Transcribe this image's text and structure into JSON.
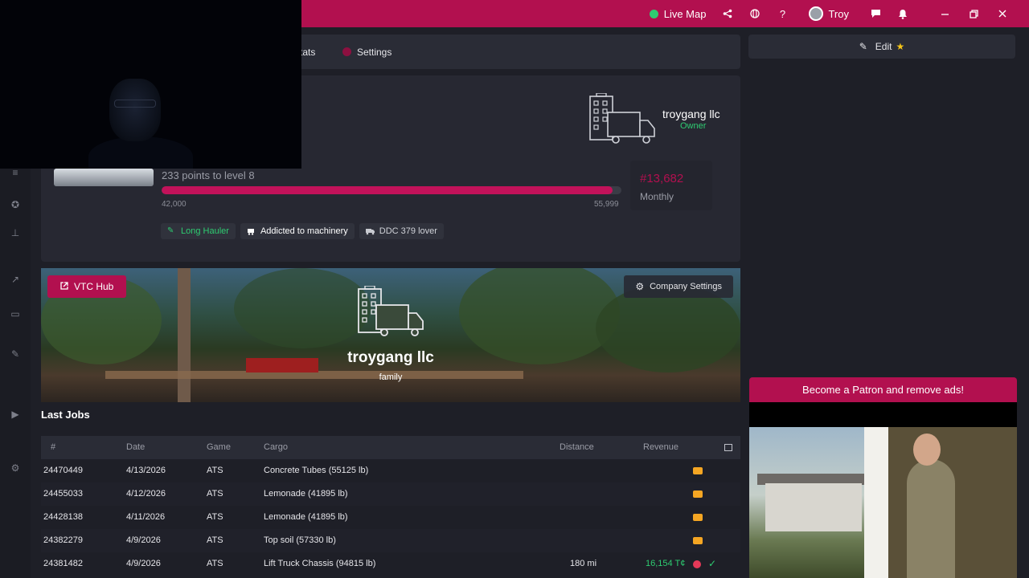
{
  "topbar": {
    "live_map": "Live Map",
    "user_name": "Troy",
    "icons": [
      "share-icon",
      "globe-icon",
      "help-icon",
      "chat-icon",
      "bell-icon",
      "minimize-icon",
      "restore-icon",
      "close-icon"
    ]
  },
  "nav": {
    "tabs": [
      {
        "label": "tats"
      },
      {
        "label": "Settings"
      }
    ]
  },
  "profile": {
    "points_text": "233 points to level 8",
    "level_progress": 0.98,
    "level_min": "42,000",
    "level_max": "55,999",
    "rank": "#13,682",
    "rank_period": "Monthly",
    "company_name": "troygang llc",
    "company_role": "Owner",
    "badges": [
      {
        "label": "Long Hauler",
        "color": "#2ecc71"
      },
      {
        "label": "Addicted to machinery",
        "color": "#ffffff"
      },
      {
        "label": "DDC 379 lover",
        "color": "#d0d2d8"
      }
    ]
  },
  "banner": {
    "vtc_hub": "VTC Hub",
    "company_settings": "Company Settings",
    "company_name": "troygang llc",
    "tagline": "family"
  },
  "jobs": {
    "title": "Last Jobs",
    "headers": [
      "#",
      "Date",
      "Game",
      "Cargo",
      "Distance",
      "Revenue"
    ],
    "rows": [
      {
        "id": "24470449",
        "date": "4/13/2026",
        "game": "ATS",
        "cargo": "Concrete Tubes (55125 lb)",
        "distance": "",
        "revenue": "",
        "status": "in-progress"
      },
      {
        "id": "24455033",
        "date": "4/12/2026",
        "game": "ATS",
        "cargo": "Lemonade (41895 lb)",
        "distance": "",
        "revenue": "",
        "status": "in-progress"
      },
      {
        "id": "24428138",
        "date": "4/11/2026",
        "game": "ATS",
        "cargo": "Lemonade (41895 lb)",
        "distance": "",
        "revenue": "",
        "status": "in-progress"
      },
      {
        "id": "24382279",
        "date": "4/9/2026",
        "game": "ATS",
        "cargo": "Top soil (57330 lb)",
        "distance": "",
        "revenue": "",
        "status": "in-progress"
      },
      {
        "id": "24381482",
        "date": "4/9/2026",
        "game": "ATS",
        "cargo": "Lift Truck Chassis (94815 lb)",
        "distance": "180 mi",
        "revenue": "16,154 T¢",
        "status": "delivered"
      }
    ]
  },
  "right": {
    "edit_label": "Edit",
    "patron_label": "Become a Patron and remove ads!"
  },
  "colors": {
    "accent": "#b2104f",
    "green": "#2ecc71",
    "truck": "#f5a623"
  }
}
